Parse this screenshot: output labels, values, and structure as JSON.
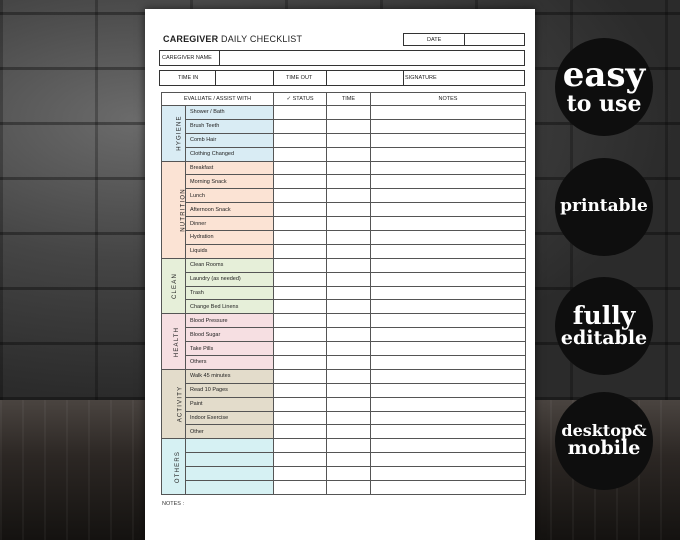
{
  "form": {
    "title_bold": "CAREGIVER",
    "title_rest": " DAILY CHECKLIST",
    "date_label": "DATE",
    "caregiver_name_label": "CAREGIVER NAME",
    "time_in_label": "TIME IN",
    "time_out_label": "TIME OUT",
    "signature_label": "SIGNATURE",
    "notes_label": "NOTES :"
  },
  "table": {
    "headers": [
      "EVALUATE / ASSIST WITH",
      "✓ STATUS",
      "TIME",
      "NOTES"
    ],
    "categories": [
      {
        "name": "HYGIENE",
        "color": "#d9ecf4",
        "items": [
          "Shower / Bath",
          "Brush Teeth",
          "Comb Hair",
          "Clothing Changed"
        ]
      },
      {
        "name": "NUTRITION",
        "color": "#fbe3d4",
        "items": [
          "Breakfast",
          "Morning Snack",
          "Lunch",
          "Afternoon Snack",
          "Dinner",
          "Hydration",
          "Liquids"
        ]
      },
      {
        "name": "CLEAN",
        "color": "#e6efd9",
        "items": [
          "Clean Rooms",
          "Laundry (as needed)",
          "Trash",
          "Change Bed Linens"
        ]
      },
      {
        "name": "HEALTH",
        "color": "#f6dfe2",
        "items": [
          "Blood Pressure",
          "Blood Sugar",
          "Take Pills",
          "Others"
        ]
      },
      {
        "name": "ACTIVITY",
        "color": "#e3dccb",
        "items": [
          "Walk 45 minutes",
          "Read 10 Pages",
          "Paint",
          "Indoor Exercise",
          "Other"
        ]
      },
      {
        "name": "OTHERS",
        "color": "#d6f1f3",
        "items": [
          "",
          "",
          "",
          ""
        ]
      }
    ]
  },
  "badges": [
    {
      "lines": [
        "easy",
        "to use"
      ]
    },
    {
      "lines": [
        "printable"
      ]
    },
    {
      "lines": [
        "fully",
        "editable"
      ]
    },
    {
      "lines": [
        "desktop&",
        "mobile"
      ]
    }
  ]
}
